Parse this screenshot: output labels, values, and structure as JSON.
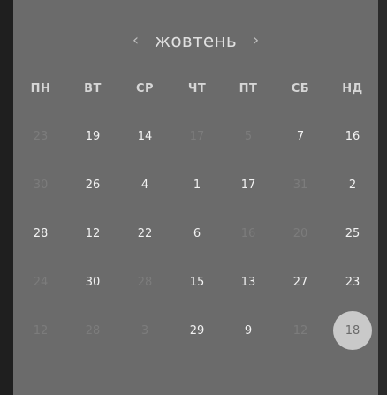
{
  "calendar": {
    "month": "жовтень",
    "prev_icon": "‹",
    "next_icon": "›",
    "weekdays": [
      "ПН",
      "ВТ",
      "СР",
      "ЧТ",
      "ПТ",
      "СБ",
      "НД"
    ],
    "weeks": [
      [
        {
          "text": "23",
          "muted": true
        },
        {
          "text": "19",
          "muted": false
        },
        {
          "text": "14",
          "muted": false
        },
        {
          "text": "17",
          "muted": true
        },
        {
          "text": "5",
          "muted": true
        },
        {
          "text": "7",
          "muted": false
        },
        {
          "text": "16",
          "muted": false
        }
      ],
      [
        {
          "text": "30",
          "muted": true
        },
        {
          "text": "26",
          "muted": false
        },
        {
          "text": "4",
          "muted": false
        },
        {
          "text": "1",
          "muted": false
        },
        {
          "text": "17",
          "muted": false
        },
        {
          "text": "31",
          "muted": true
        },
        {
          "text": "2",
          "muted": false
        }
      ],
      [
        {
          "text": "28",
          "muted": false
        },
        {
          "text": "12",
          "muted": false
        },
        {
          "text": "22",
          "muted": false
        },
        {
          "text": "6",
          "muted": false
        },
        {
          "text": "16",
          "muted": true
        },
        {
          "text": "20",
          "muted": true
        },
        {
          "text": "25",
          "muted": false
        }
      ],
      [
        {
          "text": "24",
          "muted": true
        },
        {
          "text": "30",
          "muted": false
        },
        {
          "text": "28",
          "muted": true
        },
        {
          "text": "15",
          "muted": false
        },
        {
          "text": "13",
          "muted": false
        },
        {
          "text": "27",
          "muted": false
        },
        {
          "text": "23",
          "muted": false
        }
      ],
      [
        {
          "text": "12",
          "muted": true
        },
        {
          "text": "28",
          "muted": true
        },
        {
          "text": "3",
          "muted": true
        },
        {
          "text": "29",
          "muted": false
        },
        {
          "text": "9",
          "muted": false
        },
        {
          "text": "12",
          "muted": true
        },
        {
          "text": "18",
          "muted": false,
          "selected": true
        }
      ]
    ]
  },
  "colors": {
    "panel": "#6b6b6b",
    "text": "#f2f2f2",
    "muted_text": "#7c7c7c",
    "selected_bg": "#c9c9c9"
  }
}
